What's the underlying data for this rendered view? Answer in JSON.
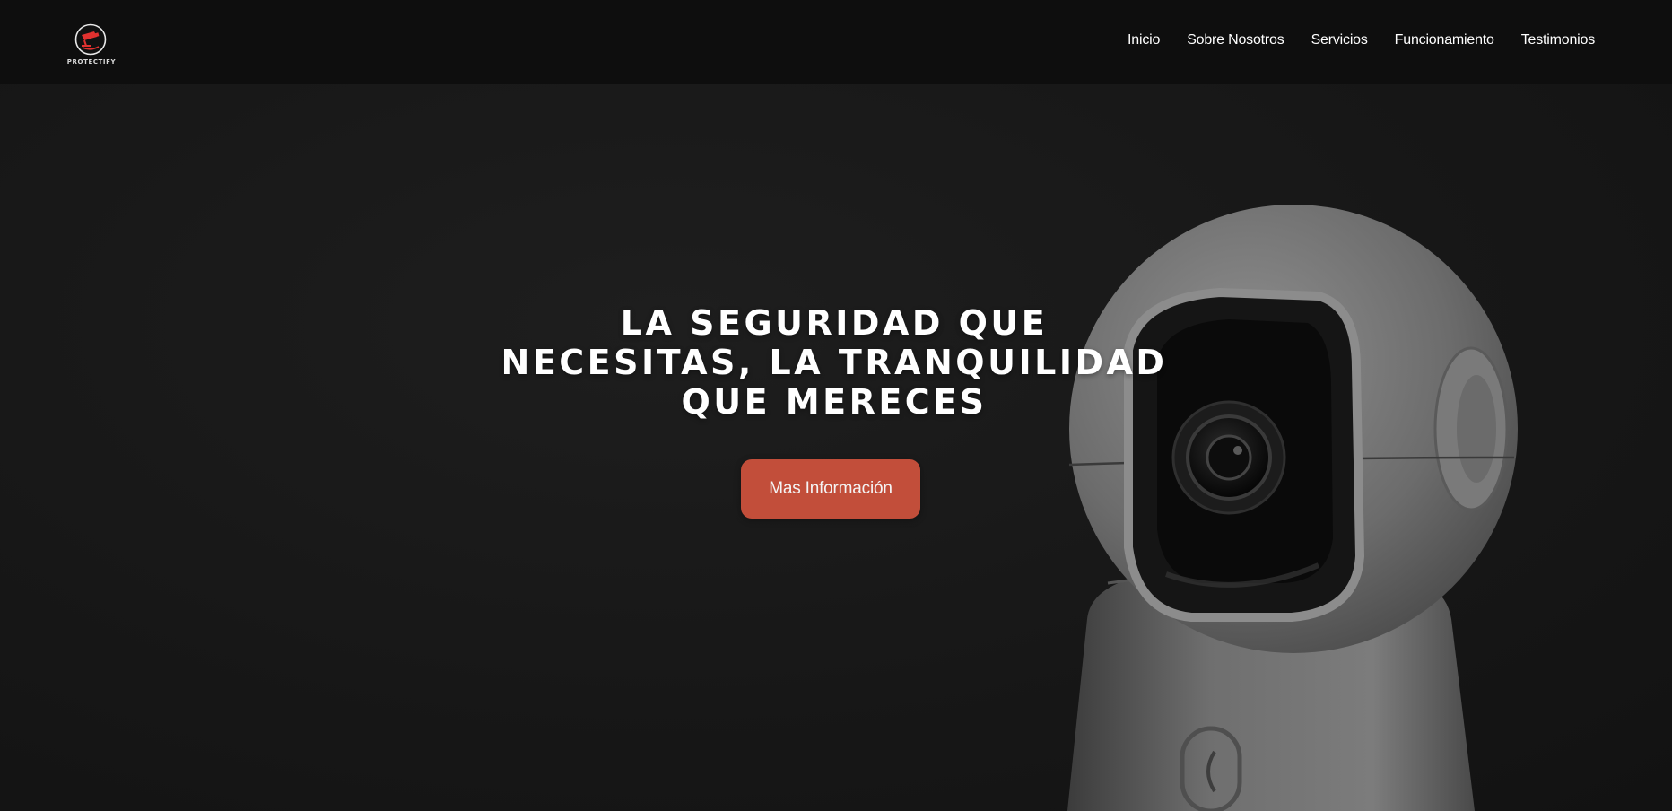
{
  "brand": {
    "name": "PROTECTIFY",
    "logo_icon": "security-camera-icon",
    "accent_color": "#e0312f"
  },
  "nav": {
    "items": [
      {
        "label": "Inicio"
      },
      {
        "label": "Sobre Nosotros"
      },
      {
        "label": "Servicios"
      },
      {
        "label": "Funcionamiento"
      },
      {
        "label": "Testimonios"
      }
    ]
  },
  "hero": {
    "title_lines": [
      "LA SEGURIDAD QUE",
      "NECESITAS, LA TRANQUILIDAD",
      "QUE MERECES"
    ],
    "cta_label": "Mas Información",
    "cta_color": "#c24e3a"
  }
}
